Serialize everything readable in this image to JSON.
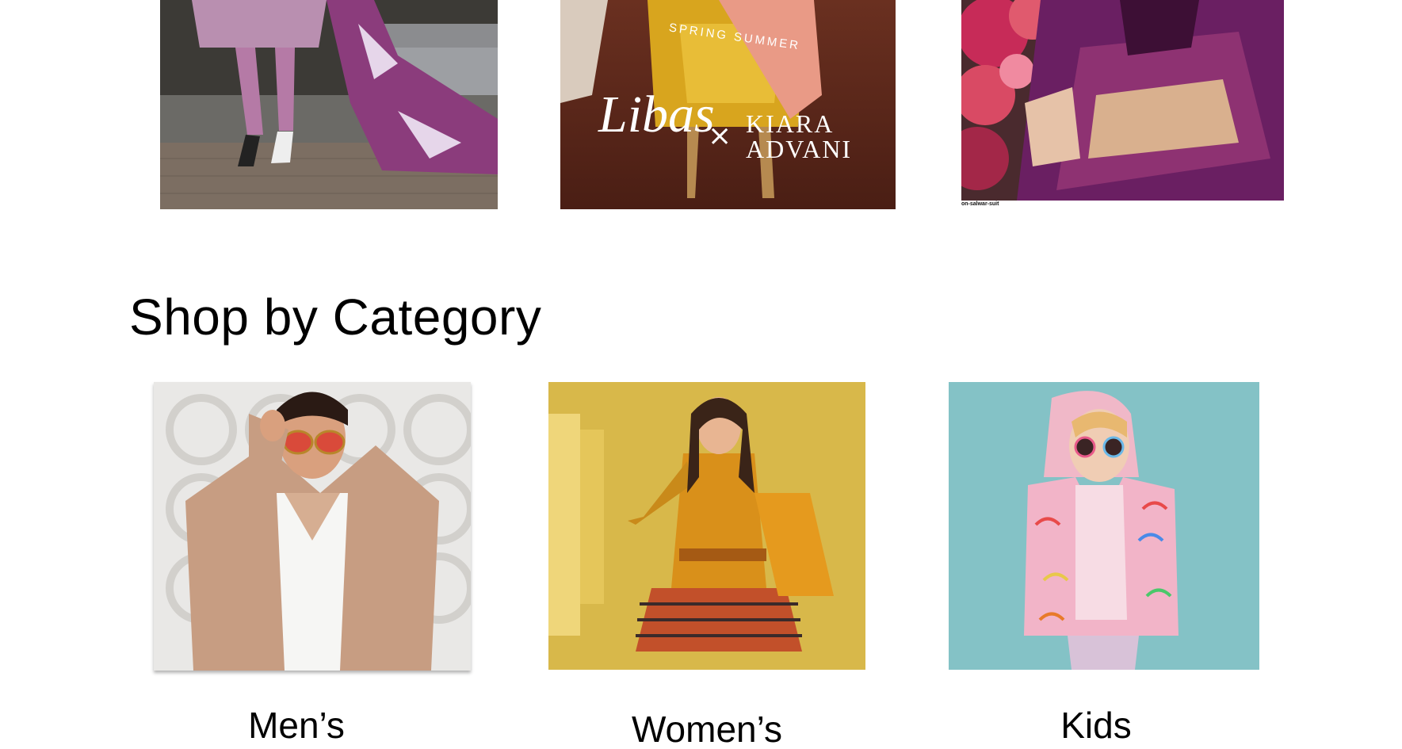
{
  "banners": [
    {
      "id": "banner-1",
      "alt": "Lavender embroidered suit on poolside deck"
    },
    {
      "id": "banner-2",
      "season_text": "SPRING SUMMER",
      "brand": "Libas",
      "cross": "×",
      "collab_line1": "KIARA",
      "collab_line2": "ADVANI"
    },
    {
      "id": "banner-3",
      "alt": "Purple printed suit with flowers",
      "caption": "on-salwar-suit"
    }
  ],
  "section": {
    "title": "Shop by Category"
  },
  "categories": [
    {
      "label": "Men’s"
    },
    {
      "label": "Women’s"
    },
    {
      "label": "Kids"
    }
  ],
  "colors": {
    "banner2_bg": "#5a2a1e",
    "banner3_purple": "#6a1f62",
    "women_bg": "#d8b84a",
    "kids_bg": "#84c2c6"
  }
}
